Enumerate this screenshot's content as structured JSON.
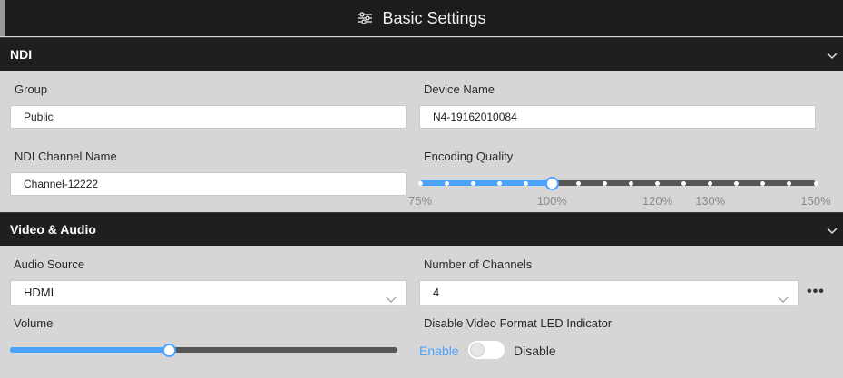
{
  "header": {
    "title": "Basic Settings",
    "icon": "settings-sliders-icon"
  },
  "ndi": {
    "section_label": "NDI",
    "group": {
      "label": "Group",
      "value": "Public"
    },
    "device_name": {
      "label": "Device Name",
      "value": "N4-19162010084"
    },
    "channel_name": {
      "label": "NDI Channel Name",
      "value": "Channel-12222"
    },
    "encoding_quality": {
      "label": "Encoding Quality",
      "min": 75,
      "max": 150,
      "value": 100,
      "tick_values": [
        75,
        80,
        85,
        90,
        95,
        100,
        105,
        110,
        115,
        120,
        125,
        130,
        135,
        140,
        145,
        150
      ],
      "tick_labels": [
        {
          "text": "75%",
          "value": 75
        },
        {
          "text": "100%",
          "value": 100
        },
        {
          "text": "120%",
          "value": 120
        },
        {
          "text": "130%",
          "value": 130
        },
        {
          "text": "150%",
          "value": 150
        }
      ]
    }
  },
  "video_audio": {
    "section_label": "Video & Audio",
    "audio_source": {
      "label": "Audio Source",
      "value": "HDMI"
    },
    "channels": {
      "label": "Number of Channels",
      "value": "4",
      "more": "•••"
    },
    "volume": {
      "label": "Volume",
      "fraction": 0.41
    },
    "led_indicator": {
      "label": "Disable Video Format LED Indicator",
      "enable_label": "Enable",
      "disable_label": "Disable",
      "enabled": true
    }
  },
  "colors": {
    "accent": "#4aa3ff",
    "header_bg": "#1f1f1f",
    "panel_bg": "#d6d6d6"
  }
}
